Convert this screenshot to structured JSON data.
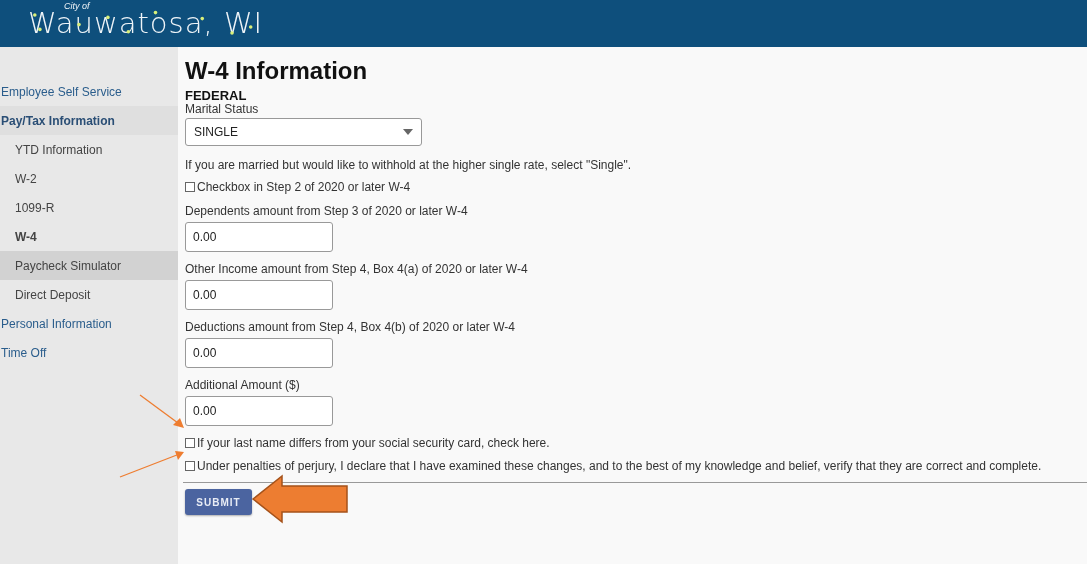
{
  "header": {
    "logo_small": "City of",
    "logo": "Wauwatosa, WI"
  },
  "sidebar": {
    "items": [
      {
        "label": "Employee Self Service",
        "selected": false,
        "highlighted": false
      },
      {
        "label": "Pay/Tax Information",
        "selected": true,
        "highlighted": false,
        "children": [
          {
            "label": "YTD Information",
            "selected": false,
            "highlighted": false
          },
          {
            "label": "W-2",
            "selected": false,
            "highlighted": false
          },
          {
            "label": "1099-R",
            "selected": false,
            "highlighted": false
          },
          {
            "label": "W-4",
            "selected": true,
            "highlighted": false
          },
          {
            "label": "Paycheck Simulator",
            "selected": false,
            "highlighted": true
          },
          {
            "label": "Direct Deposit",
            "selected": false,
            "highlighted": false
          }
        ]
      },
      {
        "label": "Personal Information",
        "selected": false,
        "highlighted": false
      },
      {
        "label": "Time Off",
        "selected": false,
        "highlighted": false
      }
    ]
  },
  "page": {
    "title": "W-4 Information",
    "section": "FEDERAL",
    "fields": [
      {
        "kind": "select",
        "label": "Marital Status",
        "value": "SINGLE"
      },
      {
        "kind": "note",
        "label": "If you are married but would like to withhold at the higher single rate, select \"Single\"."
      },
      {
        "kind": "checkbox",
        "label": "Checkbox in Step 2 of 2020 or later W-4",
        "checked": false
      },
      {
        "kind": "input",
        "label": "Dependents amount from Step 3 of 2020 or later W-4",
        "value": "0.00"
      },
      {
        "kind": "input",
        "label": "Other Income amount from Step 4, Box 4(a) of 2020 or later W-4",
        "value": "0.00"
      },
      {
        "kind": "input",
        "label": "Deductions amount from Step 4, Box 4(b) of 2020 or later W-4",
        "value": "0.00"
      },
      {
        "kind": "input",
        "label": "Additional Amount ($)",
        "value": "0.00"
      },
      {
        "kind": "checkbox",
        "label": "If your last name differs from your social security card, check here.",
        "checked": false
      },
      {
        "kind": "checkbox",
        "label": "Under penalties of perjury, I declare that I have examined these changes, and to the best of my knowledge and belief, verify that they are correct and complete.",
        "checked": false
      }
    ],
    "submit": "SUBMIT"
  },
  "annotations": [
    {
      "kind": "thin-arrow"
    },
    {
      "kind": "thin-arrow"
    },
    {
      "kind": "block-arrow"
    }
  ]
}
